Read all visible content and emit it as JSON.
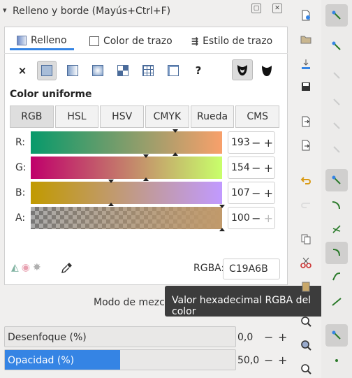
{
  "window": {
    "title": "Relleno y borde (Mayús+Ctrl+F)",
    "restore_glyph": "▢",
    "close_glyph": "✕"
  },
  "tabs": [
    {
      "label": "Relleno",
      "icon": "gradient-fill-icon"
    },
    {
      "label": "Color de trazo",
      "icon": "stroke-paint-icon"
    },
    {
      "label": "Estilo de trazo",
      "icon": "stroke-style-icon"
    }
  ],
  "paint_types": [
    {
      "name": "no-paint",
      "glyph": "×"
    },
    {
      "name": "flat-color",
      "glyph": ""
    },
    {
      "name": "linear-gradient",
      "glyph": ""
    },
    {
      "name": "radial-gradient",
      "glyph": ""
    },
    {
      "name": "pattern",
      "glyph": ""
    },
    {
      "name": "swatch",
      "glyph": ""
    },
    {
      "name": "mesh",
      "glyph": ""
    },
    {
      "name": "unset",
      "glyph": "?"
    }
  ],
  "heading": "Color uniforme",
  "modes": [
    "RGB",
    "HSL",
    "HSV",
    "CMYK",
    "Rueda",
    "CMS"
  ],
  "channels": [
    {
      "label": "R:",
      "value": "193",
      "fraction": 0.757
    },
    {
      "label": "G:",
      "value": "154",
      "fraction": 0.604
    },
    {
      "label": "B:",
      "value": "107",
      "fraction": 0.42
    },
    {
      "label": "A:",
      "value": "100",
      "fraction": 1.0
    }
  ],
  "rgba": {
    "label": "RGBA:",
    "value": "C19A6B"
  },
  "blend_label": "Modo de mezcla",
  "tooltip": "Valor hexadecimal RGBA del color",
  "blur": {
    "label": "Desenfoque (%)",
    "value": "0,0",
    "fraction": 0.0
  },
  "opacity": {
    "label": "Opacidad (%)",
    "value": "50,0",
    "fraction": 0.5
  },
  "controls": {
    "minus": "−",
    "plus": "+"
  }
}
